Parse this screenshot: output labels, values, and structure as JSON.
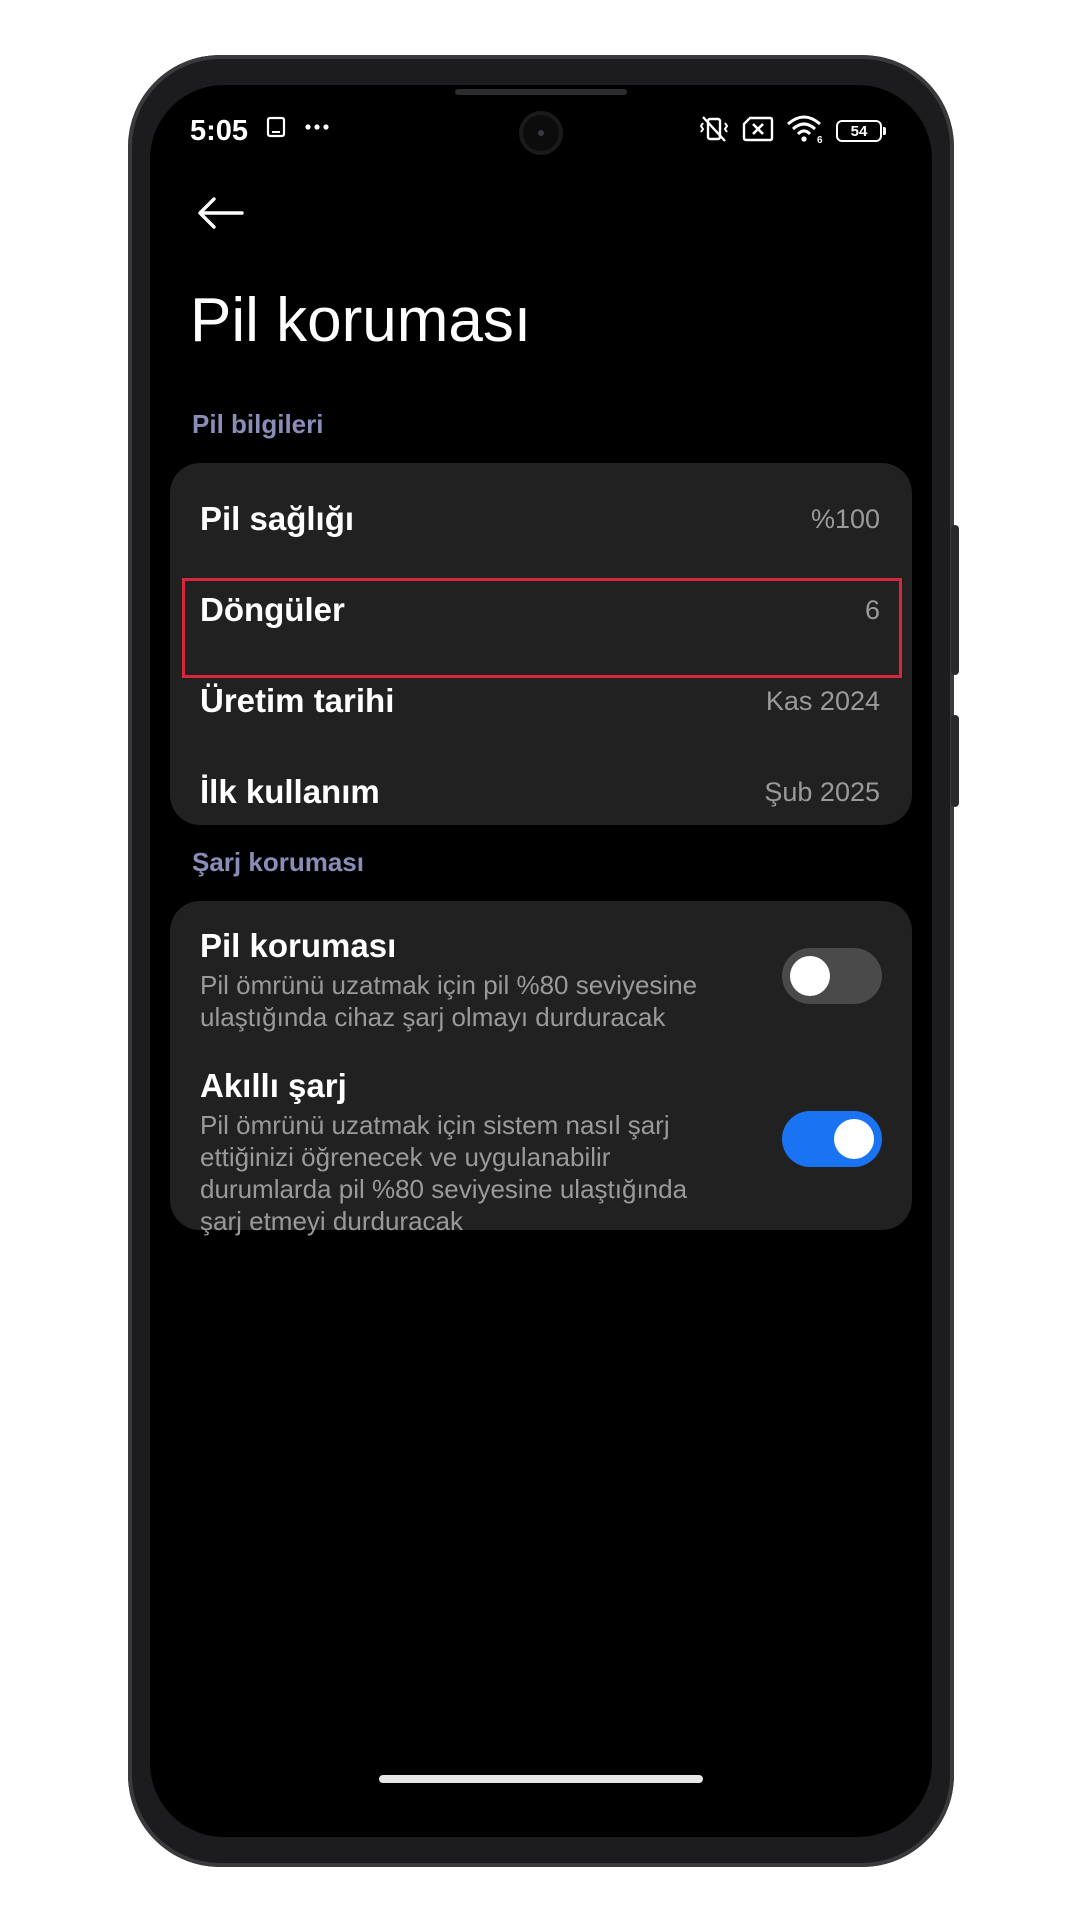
{
  "status_bar": {
    "time": "5:05",
    "left_icons": [
      "screen-record-icon",
      "more-dots-icon"
    ],
    "right_icons": [
      "vibrate-off-icon",
      "sim-x-icon",
      "wifi-icon",
      "battery-icon"
    ],
    "battery_level": "54"
  },
  "header": {
    "back_icon": "back-arrow-icon",
    "title": "Pil koruması"
  },
  "sections": {
    "battery_info": {
      "label": "Pil bilgileri",
      "rows": [
        {
          "label": "Pil sağlığı",
          "value": "%100"
        },
        {
          "label": "Döngüler",
          "value": "6"
        },
        {
          "label": "Üretim tarihi",
          "value": "Kas 2024"
        },
        {
          "label": "İlk kullanım",
          "value": "Şub 2025"
        }
      ]
    },
    "charge_protection": {
      "label": "Şarj koruması",
      "toggles": [
        {
          "title": "Pil koruması",
          "description": "Pil ömrünü uzatmak için pil %80 seviyesine ulaştığında cihaz şarj olmayı durduracak",
          "enabled": false
        },
        {
          "title": "Akıllı şarj",
          "description": "Pil ömrünü uzatmak için sistem nasıl şarj ettiğinizi öğrenecek ve uygulanabilir durumlarda pil %80 seviyesine ulaştığında şarj etmeyi durduracak",
          "enabled": true
        }
      ]
    }
  },
  "colors": {
    "toggle_on": "#1a73f2",
    "toggle_off": "#4a4a4a",
    "highlight_border": "#d7273d",
    "section_label": "#8a8db8"
  }
}
